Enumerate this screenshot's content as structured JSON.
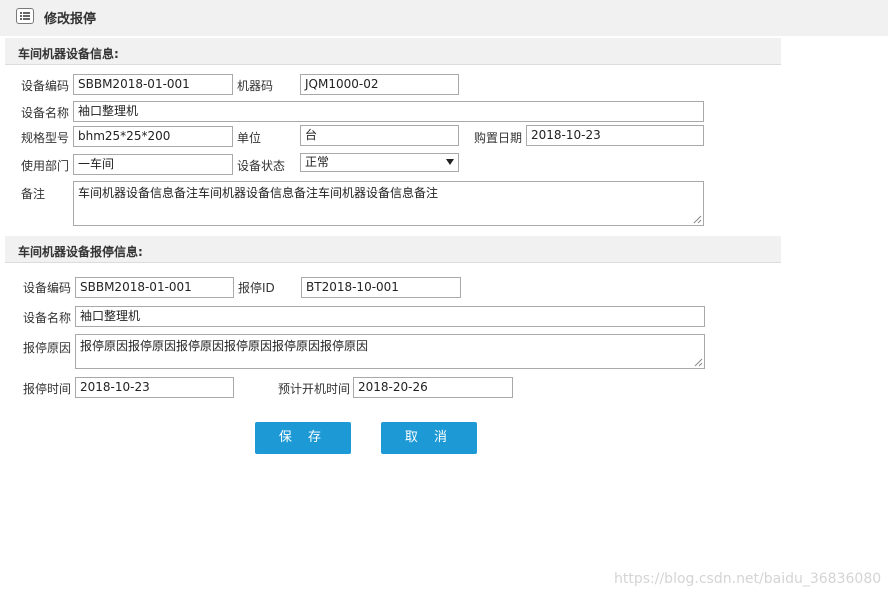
{
  "header": {
    "title": "修改报停",
    "icon": "list-icon"
  },
  "section1": {
    "title": "车间机器设备信息:",
    "labels": {
      "code": "设备编码",
      "machine_code": "机器码",
      "name": "设备名称",
      "spec": "规格型号",
      "unit": "单位",
      "purchase_date": "购置日期",
      "department": "使用部门",
      "status": "设备状态",
      "remark": "备注"
    },
    "values": {
      "code": "SBBM2018-01-001",
      "machine_code": "JQM1000-02",
      "name": "袖口整理机",
      "spec": "bhm25*25*200",
      "unit": "台",
      "purchase_date": "2018-10-23",
      "department": "一车间",
      "status": "正常",
      "remark": "车间机器设备信息备注车间机器设备信息备注车间机器设备信息备注"
    }
  },
  "section2": {
    "title": "车间机器设备报停信息:",
    "labels": {
      "code": "设备编码",
      "stop_id": "报停ID",
      "name": "设备名称",
      "reason": "报停原因",
      "stop_time": "报停时间",
      "restart_time": "预计开机时间"
    },
    "values": {
      "code": "SBBM2018-01-001",
      "stop_id": "BT2018-10-001",
      "name": "袖口整理机",
      "reason": "报停原因报停原因报停原因报停原因报停原因报停原因",
      "stop_time": "2018-10-23",
      "restart_time": "2018-20-26"
    }
  },
  "buttons": {
    "save": "保 存",
    "cancel": "取 消"
  },
  "watermark": "https://blog.csdn.net/baidu_36836080"
}
